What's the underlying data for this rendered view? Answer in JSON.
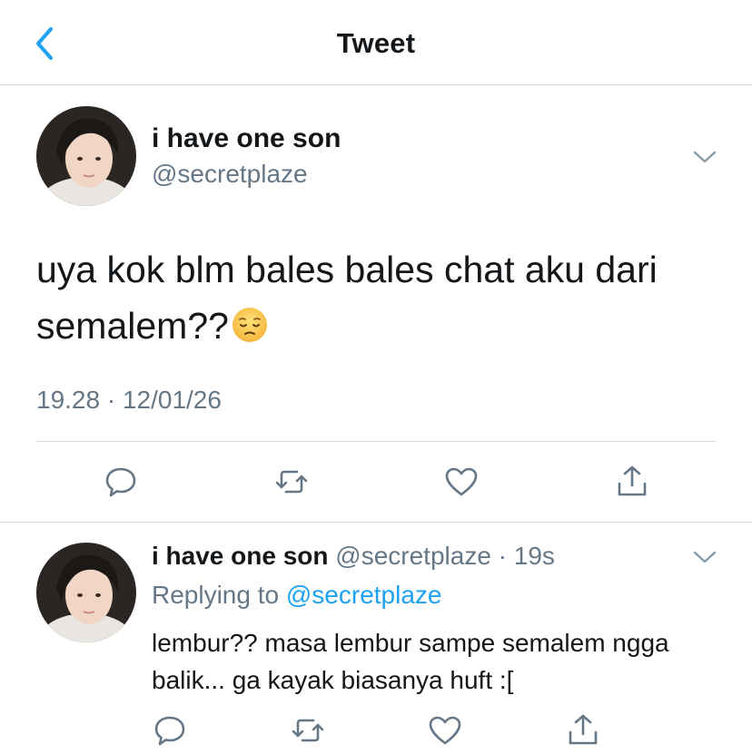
{
  "header": {
    "title": "Tweet"
  },
  "main_tweet": {
    "display_name": "i have one son",
    "handle": "@secretplaze",
    "text": "uya kok blm bales bales chat aku dari semalem??",
    "emoji_icon": "pensive-face-emoji",
    "timestamp": "19.28 · 12/01/26"
  },
  "reply_tweet": {
    "display_name": "i have one son",
    "meta": "@secretplaze · 19s",
    "replying_prefix": "Replying to",
    "replying_handle": "@secretplaze",
    "text": "lembur?? masa lembur sampe semalem ngga balik... ga kayak biasanya huft :["
  },
  "colors": {
    "accent": "#1da1f2",
    "muted_text": "#657786",
    "divider": "#d6d9dc",
    "icon": "#657786"
  }
}
